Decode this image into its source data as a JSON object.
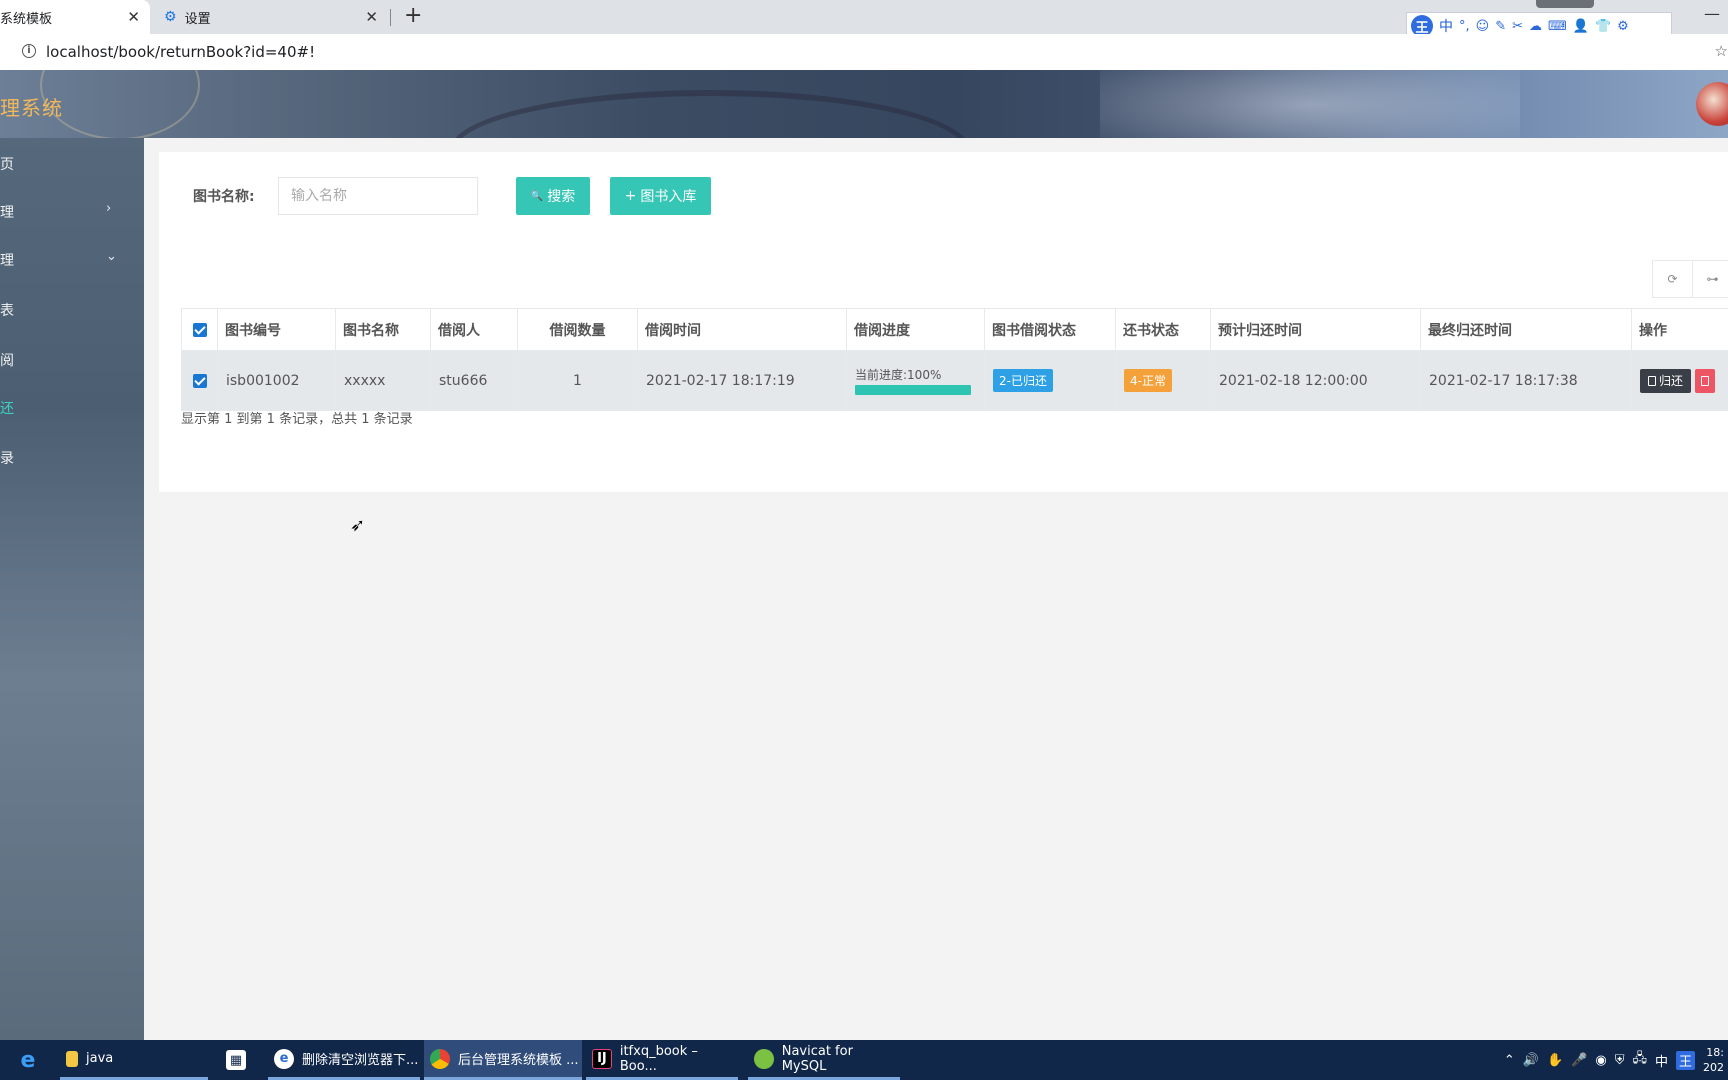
{
  "browser": {
    "active_tab_title": "系统模板",
    "inactive_tab_title": "设置",
    "url": "localhost/book/returnBook?id=40#!",
    "new_tab_symbol": "+",
    "close_symbol": "✕",
    "minimize_symbol": "—"
  },
  "ime": {
    "logo": "王",
    "mode": "中",
    "icons": [
      "°,",
      "☺",
      "✎",
      "✂",
      "☁",
      "⌨",
      "👤",
      "👕",
      "⚙"
    ]
  },
  "app": {
    "title": "理系统"
  },
  "sidebar": {
    "items": [
      {
        "label": "页",
        "arrow": ""
      },
      {
        "label": "理",
        "arrow": "›"
      },
      {
        "label": "理",
        "arrow": "⌄"
      },
      {
        "label": "表",
        "arrow": ""
      },
      {
        "label": "阅",
        "arrow": ""
      },
      {
        "label": "还",
        "arrow": "",
        "active": true
      },
      {
        "label": "录",
        "arrow": ""
      }
    ]
  },
  "search": {
    "label": "图书名称:",
    "placeholder": "输入名称",
    "search_button": "搜索",
    "add_button": "图书入库",
    "search_icon": "🔍",
    "add_icon": "+"
  },
  "toolbar": {
    "refresh_icon": "⟳",
    "columns_icon": "⊶"
  },
  "table": {
    "headers": [
      "图书编号",
      "图书名称",
      "借阅人",
      "借阅数量",
      "借阅时间",
      "借阅进度",
      "图书借阅状态",
      "还书状态",
      "预计归还时间",
      "最终归还时间",
      "操作"
    ],
    "rows": [
      {
        "book_id": "isb001002",
        "book_name": "xxxxx",
        "borrower": "stu666",
        "quantity": "1",
        "borrow_time": "2021-02-17 18:17:19",
        "progress_text": "当前进度:100%",
        "progress_value": 100,
        "borrow_status": "2-已归还",
        "return_status": "4-正常",
        "expected_return": "2021-02-18 12:00:00",
        "final_return": "2021-02-17 18:17:38",
        "action_return": "归还",
        "checked": true
      }
    ],
    "pagination": "显示第 1 到第 1 条记录，总共 1 条记录"
  },
  "taskbar": {
    "items": [
      {
        "label": "java",
        "icon": "folder-icon"
      },
      {
        "label": "",
        "icon": "store-icon"
      },
      {
        "label": "删除清空浏览器下...",
        "icon": "ie-icon"
      },
      {
        "label": "后台管理系统模板 ...",
        "icon": "chrome-icon"
      },
      {
        "label": "itfxq_book – Boo...",
        "icon": "intellij-icon"
      },
      {
        "label": "Navicat for MySQL",
        "icon": "navicat-icon"
      }
    ],
    "tray_ime": "中",
    "tray_ime2": "王",
    "clock_time": "18:",
    "clock_date": "202"
  },
  "colors": {
    "accent": "#36c6b5",
    "badge_blue": "#2ea1e6",
    "badge_orange": "#f4a13a",
    "sidebar_active": "#3fd3bf"
  }
}
